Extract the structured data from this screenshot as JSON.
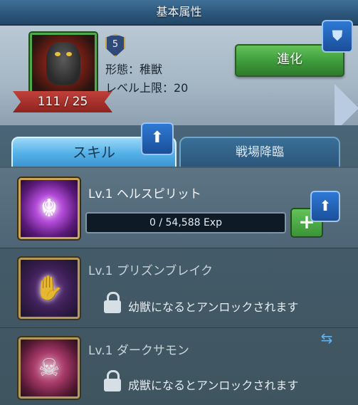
{
  "header": {
    "title": "基本属性"
  },
  "hero": {
    "level_count": "111 / 25",
    "star_level": "5",
    "form_line": "形態：稚獣",
    "level_cap_line": "レベル上限：20",
    "evolve_label": "進化"
  },
  "tabs": [
    {
      "label": "スキル",
      "active": true
    },
    {
      "label": "戦場降臨",
      "active": false
    }
  ],
  "skills": [
    {
      "name": "Lv.1 ヘルスピリット",
      "exp": "0 / 54,588 Exp",
      "locked": false
    },
    {
      "name": "Lv.1 プリズンブレイク",
      "lock_text": "幼獣になるとアンロックされます",
      "locked": true
    },
    {
      "name": "Lv.1 ダークサモン",
      "lock_text": "成獣になるとアンロックされます",
      "locked": true
    }
  ],
  "colors": {
    "accent_green": "#3d9a3a",
    "tab_blue": "#55b2e8",
    "badge_blue": "#1a4f9a"
  },
  "icons": [
    "shield-gem-icon",
    "up-arrow-icon",
    "lock-icon",
    "swap-icon",
    "plus-icon",
    "right-arrow-icon"
  ]
}
